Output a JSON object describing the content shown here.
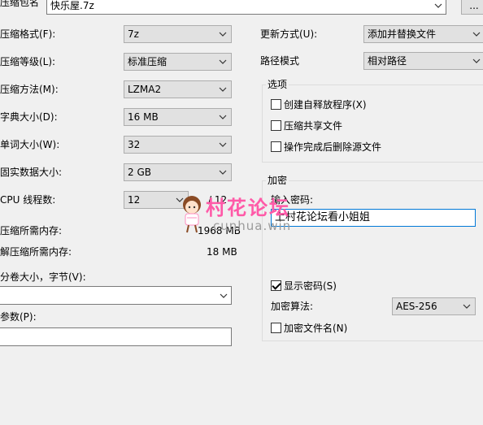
{
  "archive": {
    "label": "压缩包名",
    "value": "快乐屋.7z",
    "browse_label": "..."
  },
  "left": {
    "format_label": "压缩格式(F):",
    "format_value": "7z",
    "level_label": "压缩等级(L):",
    "level_value": "标准压缩",
    "method_label": "压缩方法(M):",
    "method_value": "LZMA2",
    "dict_label": "字典大小(D):",
    "dict_value": "16 MB",
    "word_label": "单词大小(W):",
    "word_value": "32",
    "solid_label": "固实数据大小:",
    "solid_value": "2 GB",
    "cpu_label": "CPU 线程数:",
    "cpu_value": "12",
    "cpu_total": "/ 12",
    "mem_comp_label": "压缩所需内存:",
    "mem_comp_value": "1968 MB",
    "mem_decomp_label": "解压缩所需内存:",
    "mem_decomp_value": "18 MB",
    "volume_label": "分卷大小，字节(V):",
    "volume_value": "",
    "params_label": "参数(P):",
    "params_value": ""
  },
  "right": {
    "update_label": "更新方式(U):",
    "update_value": "添加并替换文件",
    "path_label": "路径模式",
    "path_value": "相对路径",
    "options_title": "选项",
    "opt_sfx": "创建自释放程序(X)",
    "opt_shared": "压缩共享文件",
    "opt_delete": "操作完成后删除源文件",
    "encrypt_title": "加密",
    "password_label": "输入密码:",
    "password_value": "上村花论坛看小姐姐",
    "show_password": "显示密码(S)",
    "enc_method_label": "加密算法:",
    "enc_method_value": "AES-256",
    "encrypt_names": "加密文件名(N)"
  },
  "watermark": {
    "main": "村花论坛",
    "sub": "cunhua.win"
  },
  "colors": {
    "window_bg": "#f0f0f0",
    "focus_border": "#0078d7",
    "watermark": "#ff5aa8"
  }
}
